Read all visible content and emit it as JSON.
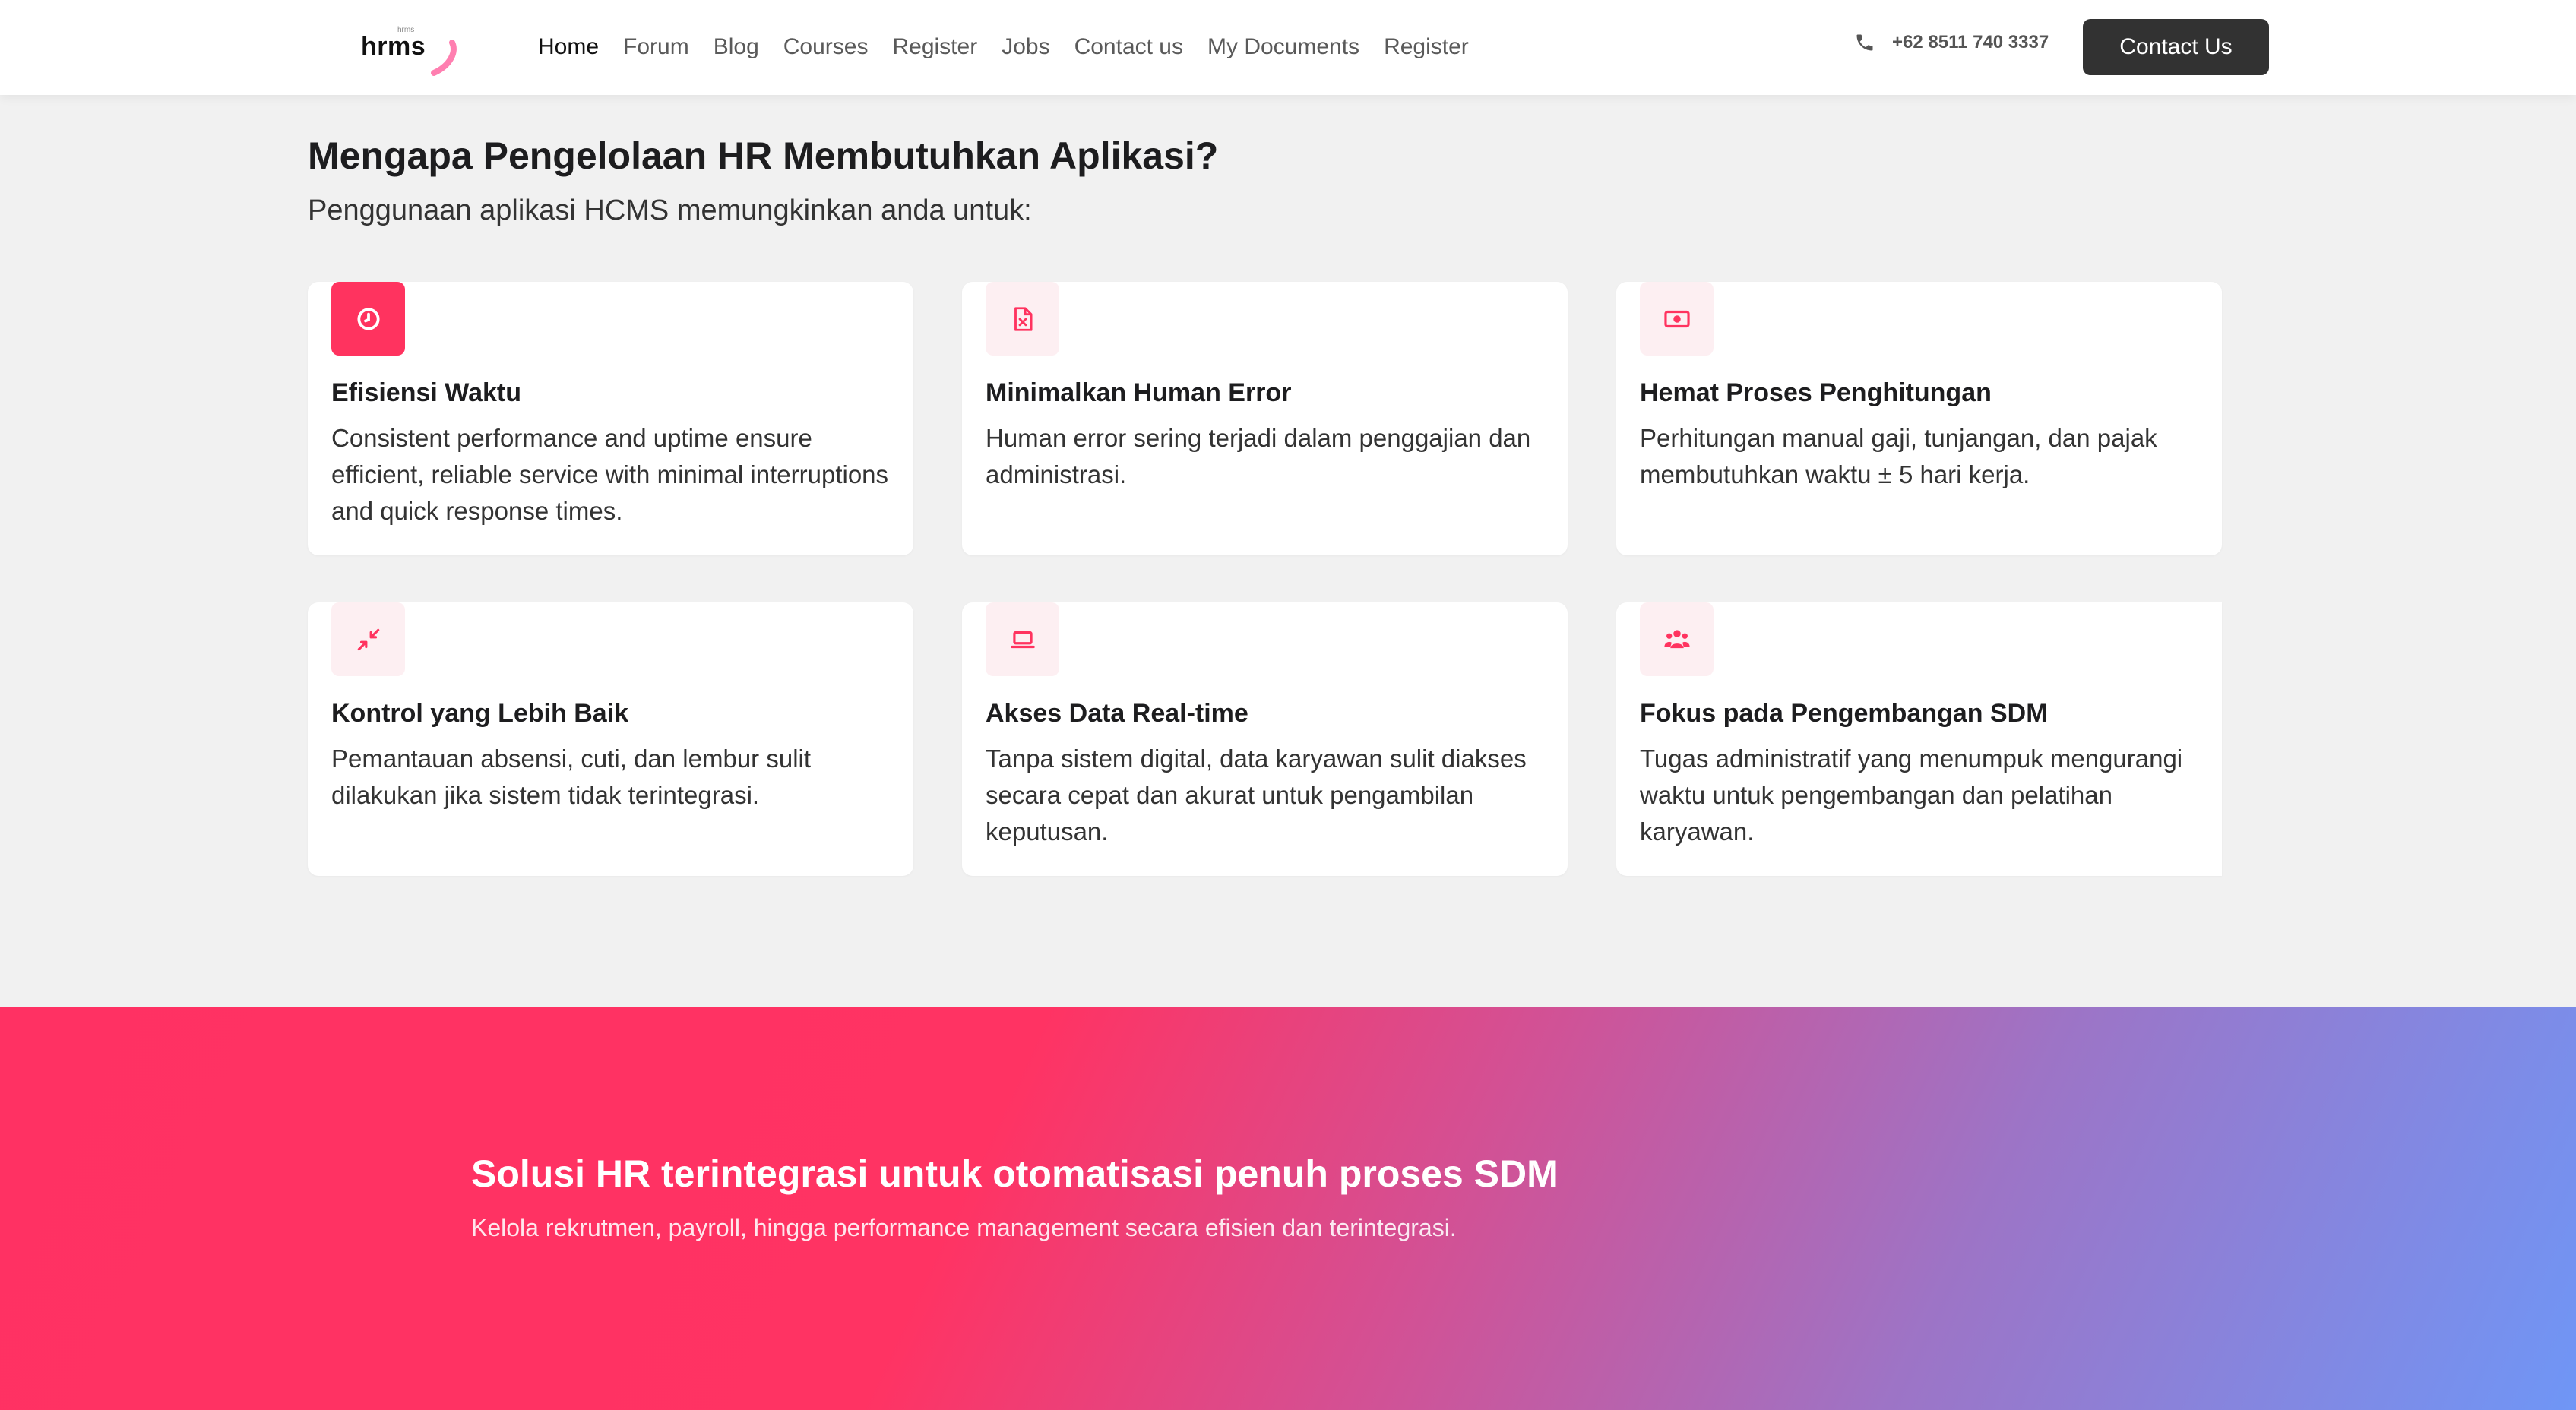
{
  "header": {
    "logo_text": "hrms",
    "logo_tag": "hrms",
    "nav": [
      {
        "label": "Home"
      },
      {
        "label": "Forum"
      },
      {
        "label": "Blog"
      },
      {
        "label": "Courses"
      },
      {
        "label": "Register"
      },
      {
        "label": "Jobs"
      },
      {
        "label": "Contact us"
      },
      {
        "label": "My Documents"
      },
      {
        "label": "Register"
      }
    ],
    "phone": "+62 8511 740 3337",
    "contact_button": "Contact Us"
  },
  "section": {
    "title": "Mengapa Pengelolaan HR Membutuhkan Aplikasi?",
    "subtitle": "Penggunaan aplikasi HCMS memungkinkan anda untuk:"
  },
  "cards": [
    {
      "icon": "clock-icon",
      "title": "Efisiensi Waktu",
      "description": "Consistent performance and uptime ensure efficient, reliable service with minimal interruptions and quick response times."
    },
    {
      "icon": "file-x-icon",
      "title": "Minimalkan Human Error",
      "description": "Human error sering terjadi dalam penggajian dan administrasi."
    },
    {
      "icon": "money-icon",
      "title": "Hemat Proses Penghitungan",
      "description": "Perhitungan manual gaji, tunjangan, dan pajak membutuhkan waktu ± 5 hari kerja."
    },
    {
      "icon": "compress-icon",
      "title": "Kontrol yang Lebih Baik",
      "description": "Pemantauan absensi, cuti, dan lembur sulit dilakukan jika sistem tidak terintegrasi."
    },
    {
      "icon": "laptop-icon",
      "title": "Akses Data Real-time",
      "description": "Tanpa sistem digital, data karyawan sulit diakses secara cepat dan akurat untuk pengambilan keputusan."
    },
    {
      "icon": "users-icon",
      "title": "Fokus pada Pengembangan SDM",
      "description": "Tugas administratif yang menumpuk mengurangi waktu untuk pengembangan dan pelatihan karyawan."
    }
  ],
  "banner": {
    "title": "Solusi HR terintegrasi untuk otomatisasi penuh proses SDM",
    "subtitle": "Kelola rekrutmen, payroll, hingga performance management secara efisien dan terintegrasi."
  },
  "colors": {
    "accent": "#ff335f",
    "icon_bg": "#fdeff2",
    "button_dark": "#323232",
    "banner_start": "#ff3163",
    "banner_end": "#6f96f6"
  }
}
